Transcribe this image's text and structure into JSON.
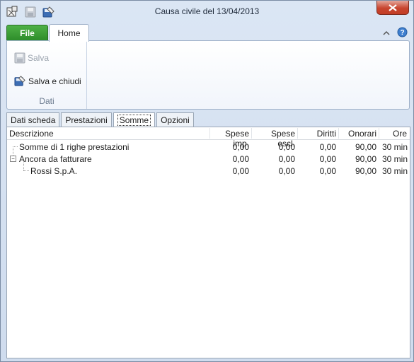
{
  "window": {
    "title": "Causa civile del 13/04/2013"
  },
  "ribbon": {
    "tabs": {
      "file": "File",
      "home": "Home"
    },
    "group_dati": {
      "label": "Dati",
      "salva": "Salva",
      "salva_chiudi": "Salva e chiudi"
    }
  },
  "tabs": [
    "Dati scheda",
    "Prestazioni",
    "Somme",
    "Opzioni"
  ],
  "active_tab": "Somme",
  "grid": {
    "columns": [
      "Descrizione",
      "Spese imp.",
      "Spese escl.",
      "Diritti",
      "Onorari",
      "Ore"
    ],
    "rows": [
      {
        "descr": "Somme di 1 righe prestazioni",
        "spese_imp": "0,00",
        "spese_escl": "0,00",
        "diritti": "0,00",
        "onorari": "90,00",
        "ore": "30 min"
      },
      {
        "descr": "Ancora da fatturare",
        "spese_imp": "0,00",
        "spese_escl": "0,00",
        "diritti": "0,00",
        "onorari": "90,00",
        "ore": "30 min"
      },
      {
        "descr": "Rossi S.p.A.",
        "spese_imp": "0,00",
        "spese_escl": "0,00",
        "diritti": "0,00",
        "onorari": "90,00",
        "ore": "30 min"
      }
    ]
  },
  "colors": {
    "file_tab": "#2c8b29",
    "close_button": "#c8452f",
    "frame": "#cfdcee"
  }
}
